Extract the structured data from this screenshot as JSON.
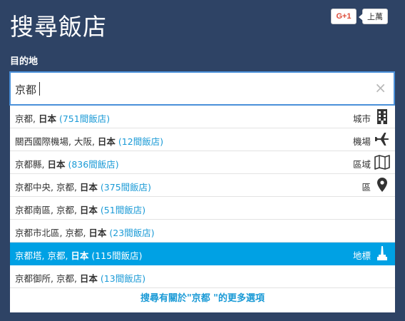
{
  "header": {
    "title": "搜尋飯店",
    "gplus_label": "G+1",
    "gplus_count": "上萬"
  },
  "search": {
    "label": "目的地",
    "value": "京都",
    "clear_symbol": "×"
  },
  "suggestions": [
    {
      "pre": "京都, ",
      "bold": "日本",
      "post": "",
      "count": "(751間飯店)",
      "type": "城市",
      "icon": "building-icon"
    },
    {
      "pre": "關西國際機場, 大阪, ",
      "bold": "日本",
      "post": "",
      "count": "(12間飯店)",
      "type": "機場",
      "icon": "airplane-icon"
    },
    {
      "pre": "京都縣, ",
      "bold": "日本",
      "post": "",
      "count": "(836間飯店)",
      "type": "區域",
      "icon": "map-icon"
    },
    {
      "pre": "京都中央, 京都, ",
      "bold": "日本",
      "post": "",
      "count": "(375間飯店)",
      "type": "區",
      "icon": "location-pin-icon"
    },
    {
      "pre": "京都南區, 京都, ",
      "bold": "日本",
      "post": "",
      "count": "(51間飯店)",
      "type": "",
      "icon": ""
    },
    {
      "pre": "京都市北區, 京都, ",
      "bold": "日本",
      "post": "",
      "count": "(23間飯店)",
      "type": "",
      "icon": ""
    },
    {
      "pre": "京都塔, 京都, ",
      "bold": "日本",
      "post": "",
      "count": "(115間飯店)",
      "type": "地標",
      "icon": "landmark-icon",
      "active": true
    },
    {
      "pre": "京都御所, 京都, ",
      "bold": "日本",
      "post": "",
      "count": "(13間飯店)",
      "type": "",
      "icon": ""
    }
  ],
  "more_link": "搜尋有關於\"京都 \"的更多選項",
  "colors": {
    "panel_bg": "#2e4365",
    "active_row": "#00a1e4",
    "count_text": "#1a9ad6"
  }
}
